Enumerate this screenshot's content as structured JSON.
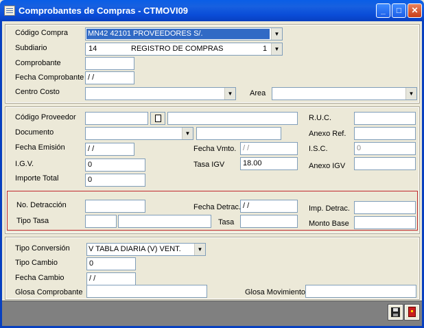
{
  "window": {
    "title": "Comprobantes de Compras - CTMOVI09",
    "minimize_label": "_",
    "maximize_label": "□",
    "close_label": "✕"
  },
  "header": {
    "codigo_compra": {
      "label": "Código Compra",
      "value": "MN42     42101     PROVEEDORES S/."
    },
    "subdiario": {
      "label": "Subdiario",
      "code": "14",
      "desc": "REGISTRO DE COMPRAS",
      "num": "1"
    },
    "comprobante": {
      "label": "Comprobante",
      "value": ""
    },
    "fecha_comprobante": {
      "label": "Fecha Comprobante",
      "value": " / /"
    },
    "centro_costo": {
      "label": "Centro Costo",
      "value": ""
    },
    "area": {
      "label": "Area",
      "value": ""
    }
  },
  "proveedor": {
    "codigo_proveedor": {
      "label": "Código Proveedor",
      "value": "",
      "name": ""
    },
    "ruc": {
      "label": "R.U.C.",
      "value": ""
    },
    "documento": {
      "label": "Documento",
      "value": "",
      "number": ""
    },
    "anexo_ref": {
      "label": "Anexo Ref.",
      "value": ""
    },
    "fecha_emision": {
      "label": "Fecha Emisión",
      "value": " / /"
    },
    "fecha_vmto": {
      "label": "Fecha Vmto.",
      "value": " / /"
    },
    "isc": {
      "label": "I.S.C.",
      "value": "0"
    },
    "igv": {
      "label": "I.G.V.",
      "value": "0"
    },
    "tasa_igv": {
      "label": "Tasa IGV",
      "value": "18.00"
    },
    "anexo_igv": {
      "label": "Anexo IGV",
      "value": ""
    },
    "importe_total": {
      "label": "Importe Total",
      "value": "0"
    }
  },
  "detraccion": {
    "no_detraccion": {
      "label": "No. Detracción",
      "value": ""
    },
    "fecha_detrac": {
      "label": "Fecha Detrac.",
      "value": " / /"
    },
    "imp_detrac": {
      "label": "Imp. Detrac.",
      "value": ""
    },
    "tipo_tasa": {
      "label": "Tipo Tasa",
      "code": "",
      "desc": ""
    },
    "tasa": {
      "label": "Tasa",
      "value": ""
    },
    "monto_base": {
      "label": "Monto Base",
      "value": ""
    }
  },
  "conversion": {
    "tipo_conversion": {
      "label": "Tipo Conversión",
      "value": "V      TABLA DIARIA (V) VENT."
    },
    "tipo_cambio": {
      "label": "Tipo Cambio",
      "value": "0"
    },
    "fecha_cambio": {
      "label": "Fecha Cambio",
      "value": " / /"
    },
    "glosa_comprobante": {
      "label": "Glosa Comprobante",
      "value": ""
    },
    "glosa_movimiento": {
      "label": "Glosa Movimiento",
      "value": ""
    }
  },
  "icons": {
    "save": "save-icon",
    "exit": "exit-door-icon",
    "file": "file-icon",
    "dropdown": "▼"
  },
  "colors": {
    "titlebar": "#0a4cd8",
    "window_bg": "#ece9d8",
    "selection": "#316ac5",
    "detraccion_border": "#c0282c",
    "bottom_bar": "#808080"
  }
}
